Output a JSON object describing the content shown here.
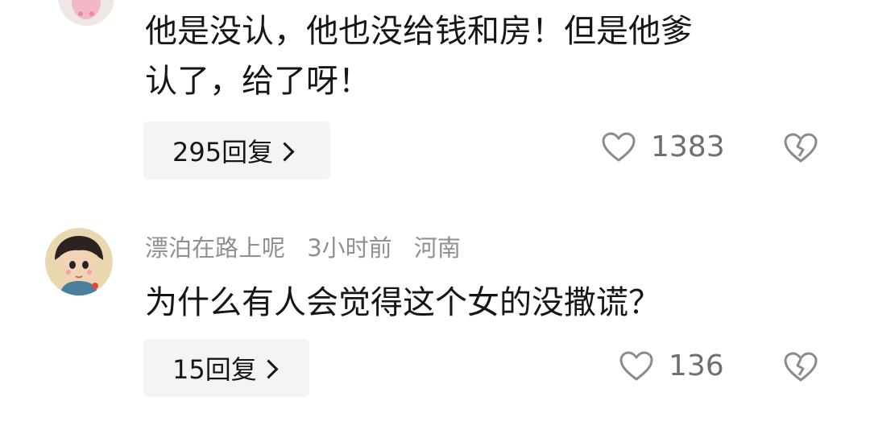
{
  "comments": [
    {
      "text_lines": [
        "他是没认，他也没给钱和房！但是他爹",
        "认了，给了呀！"
      ],
      "reply_label": "295回复",
      "like_count": "1383"
    },
    {
      "username": "漂泊在路上呢",
      "time": "3小时前",
      "location": "河南",
      "text_lines": [
        "为什么有人会觉得这个女的没撒谎？"
      ],
      "reply_label": "15回复",
      "like_count": "136"
    }
  ],
  "icons": {
    "like": "heart-outline-icon",
    "dislike": "broken-heart-icon",
    "reply_chevron": "chevron-right-icon"
  },
  "colors": {
    "text": "#161616",
    "meta": "#8f8f94",
    "reply_bg": "#f4f4f6"
  }
}
